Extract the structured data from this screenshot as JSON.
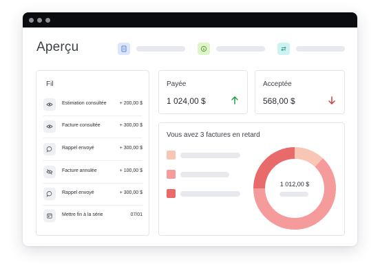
{
  "page": {
    "title": "Aperçu"
  },
  "header_placeholders": [
    {
      "icon": "document-icon",
      "color": "#dbe6fb",
      "stroke": "#5b7fd6"
    },
    {
      "icon": "dollar-circle-icon",
      "color": "#ddf5c8",
      "stroke": "#5d9e36"
    },
    {
      "icon": "transfer-arrows-icon",
      "color": "#ccf3ef",
      "stroke": "#2f9c8e"
    }
  ],
  "fil": {
    "title": "Fil",
    "items": [
      {
        "icon": "eye-icon",
        "label": "Estimation consultée",
        "value": "+ 200,00 $"
      },
      {
        "icon": "eye-icon",
        "label": "Facture consultée",
        "value": "+ 300,00 $"
      },
      {
        "icon": "chat-bubble-icon",
        "label": "Rappel envoyé",
        "value": "+ 300,00 $"
      },
      {
        "icon": "eye-off-icon",
        "label": "Facture annulée",
        "value": "+ 100,00 $"
      },
      {
        "icon": "chat-bubble-icon",
        "label": "Rappel envoyé",
        "value": "+ 300,00 $"
      },
      {
        "icon": "calendar-icon",
        "label": "Mettre fin à la série",
        "value": "07/01"
      }
    ]
  },
  "stats": {
    "paid": {
      "label": "Payée",
      "value": "1 024,00 $",
      "trend": "up",
      "trend_color": "#1f9d3a"
    },
    "accepted": {
      "label": "Acceptée",
      "value": "568,00 $",
      "trend": "down",
      "trend_color": "#d33a3a"
    }
  },
  "late": {
    "title": "Vous avez 3 factures en retard",
    "total": "1 012,00 $",
    "legend_colors": [
      "#f8c6b4",
      "#f59b9b",
      "#e86a6a"
    ],
    "donut_segments": [
      {
        "color": "#f8c6b4",
        "fraction": 0.12
      },
      {
        "color": "#f59b9b",
        "fraction": 0.63
      },
      {
        "color": "#e86a6a",
        "fraction": 0.25
      }
    ]
  }
}
